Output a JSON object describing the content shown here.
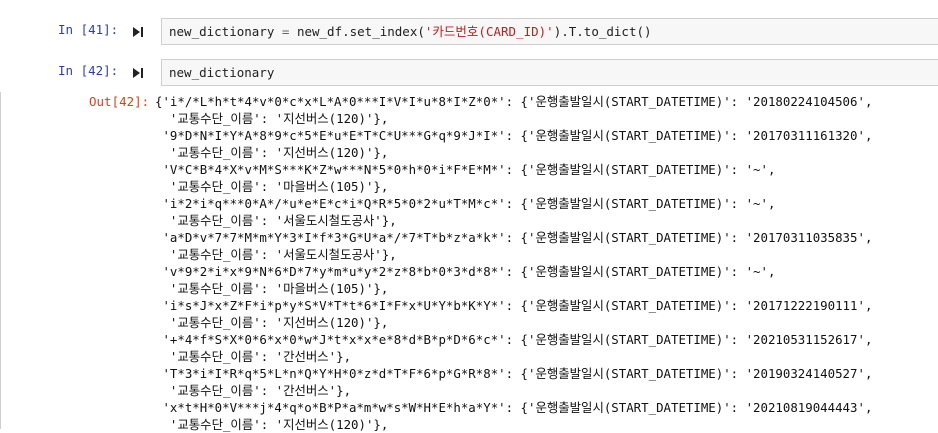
{
  "cells": [
    {
      "prompt": "In [41]:",
      "code": {
        "prefix": "new_dictionary ",
        "op1": "=",
        "mid": " new_df.set_index(",
        "str": "'카드번호(CARD_ID)'",
        "suffix": ").T.to_dict()"
      }
    },
    {
      "prompt": "In [42]:",
      "code_text": "new_dictionary"
    }
  ],
  "output": {
    "prompt": "Out[42]:",
    "lines": [
      "{'i*/*L*h*t*4*v*0*c*x*L*A*0***I*V*I*u*8*I*Z*0*': {'운행출발일시(START_DATETIME)': '20180224104506',",
      "  '교통수단_이름': '지선버스(120)'},",
      " '9*D*N*I*Y*A*8*9*c*5*E*u*E*T*C*U***G*q*9*J*I*': {'운행출발일시(START_DATETIME)': '20170311161320',",
      "  '교통수단_이름': '지선버스(120)'},",
      " 'V*C*B*4*X*v*M*S***K*Z*w***N*5*0*h*0*i*F*E*M*': {'운행출발일시(START_DATETIME)': '~',",
      "  '교통수단_이름': '마을버스(105)'},",
      " 'i*2*i*q***0*A*/*u*e*E*c*i*Q*R*5*0*2*u*T*M*c*': {'운행출발일시(START_DATETIME)': '~',",
      "  '교통수단_이름': '서울도시철도공사'},",
      " 'a*D*v*7*7*M*m*Y*3*I*f*3*G*U*a*/*7*T*b*z*a*k*': {'운행출발일시(START_DATETIME)': '20170311035835',",
      "  '교통수단_이름': '서울도시철도공사'},",
      " 'v*9*2*i*x*9*N*6*D*7*y*m*u*y*2*z*8*b*0*3*d*8*': {'운행출발일시(START_DATETIME)': '~',",
      "  '교통수단_이름': '마을버스(105)'},",
      " 'i*s*J*x*Z*F*i*p*y*S*V*T*t*6*I*F*x*U*Y*b*K*Y*': {'운행출발일시(START_DATETIME)': '20171222190111',",
      "  '교통수단_이름': '지선버스(120)'},",
      " '+*4*f*S*X*0*6*x*0*w*J*t*x*x*e*8*d*B*p*D*6*c*': {'운행출발일시(START_DATETIME)': '20210531152617',",
      "  '교통수단_이름': '간선버스'},",
      " 'T*3*i*I*R*q*5*L*n*Q*Y*H*0*z*d*T*F*6*p*G*R*8*': {'운행출발일시(START_DATETIME)': '20190324140527',",
      "  '교통수단_이름': '간선버스'},",
      " 'x*t*H*0*V***j*4*q*o*B*P*a*m*w*s*W*H*E*h*a*Y*': {'운행출발일시(START_DATETIME)': '20210819044443',",
      "  '교통수단_이름': '지선버스(120)'},"
    ]
  },
  "icons": {
    "run": "run-step-icon"
  }
}
